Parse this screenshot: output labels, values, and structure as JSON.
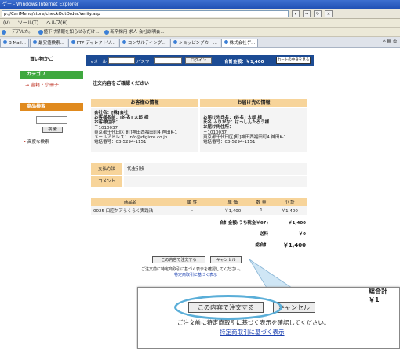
{
  "browser": {
    "title": "ゲー - Windows Internet Explorer",
    "address": "p://CartMenu/store/checkOutOrder.Verify.asp",
    "menu": [
      "(V)",
      "ツール(T)",
      "ヘルプ(H)"
    ],
    "favorites": [
      "ーデアルカ。",
      "値下げ情報を知らせるだけ...",
      "新卒採用 求人 会社説明会..."
    ],
    "tabs": [
      "B Mail...",
      "最安値検索...",
      "FTP ディレクトリ...",
      "コンサルティング...",
      "ショッピングカー...",
      "株式会社ゲ..."
    ]
  },
  "sidebar": {
    "cart_title": "買い物かご",
    "category_head": "カテゴリ",
    "category_item": "書籍・小冊子",
    "product_search_head": "商品検索",
    "search_button": "検 索",
    "advanced_search": "高度な検索"
  },
  "header": {
    "email_label": "eメール",
    "password_label": "パスワード",
    "login_button": "ログイン",
    "cart_total": "合計金額：￥1,400",
    "cart_view_button": "カートの中身を見る"
  },
  "confirm": {
    "title": "注文内容をご確認ください",
    "customer_head": "お客様の情報",
    "shipping_head": "お届け先の情報",
    "customer": {
      "company": "会社名：[株]会社",
      "name": "お客様名前：[姓名] 太郎 様",
      "address_label": "お客様住所：",
      "zip": "〒1010037",
      "address": "東京都千代田区[町]神田西福田町4 神田K-1",
      "email": "メールアドレス：info@digicre.co.jp",
      "phone": "電話番号：03-5294-1151"
    },
    "shipping": {
      "name": "お届け先氏名：[姓名] 太郎 様",
      "kana": "氏名 ふりがな：はっしんたろう様",
      "address_label": "お届け先住所：",
      "zip": "〒1010037",
      "address": "東京都千代田区[町]神田西福田町4 神田K-1",
      "phone": "電話番号：03-5294-1151"
    },
    "payment_label": "支払方法",
    "payment_value": "代金引換",
    "comment_label": "コメント",
    "comment_value": ""
  },
  "items": {
    "headers": [
      "商品名",
      "属 性",
      "単 価",
      "数 量",
      "小 計"
    ],
    "rows": [
      {
        "name": "0025 口腔ケアらくらく実践法",
        "attr": "-",
        "price": "￥1,400",
        "qty": "1",
        "subtotal": "￥1,400"
      }
    ]
  },
  "summary": {
    "total_label": "合計金額(うち税金￥67)",
    "total_value": "￥1,400",
    "shipping_label": "送料",
    "shipping_value": "￥0",
    "grand_label": "総合計",
    "grand_value": "￥1,400"
  },
  "actions": {
    "order_button": "この内容で注文する",
    "cancel_button": "キャンセル",
    "note": "ご注文前に特定商取引に基づく表示を確認してください。",
    "law_link": "特定商取引に基づく表示"
  },
  "zoom": {
    "total_fragment": "総合計 ￥1"
  },
  "colors": {
    "header_blue": "#1c4b94",
    "category_green": "#3fa83f",
    "search_orange": "#e08a1e",
    "table_head": "#f7d49a",
    "highlight": "#5aaed8"
  }
}
